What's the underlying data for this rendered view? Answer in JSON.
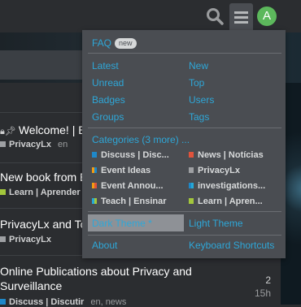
{
  "header": {
    "avatar_letter": "A"
  },
  "menu": {
    "faq": "FAQ",
    "faq_badge": "new",
    "links_left": [
      "Latest",
      "Unread",
      "Badges",
      "Groups"
    ],
    "links_right": [
      "New",
      "Top",
      "Users",
      "Tags"
    ],
    "categories_label": "Categories (3 more) ...",
    "categories": [
      {
        "label": "Discuss | Disc...",
        "color": "#1e88c9"
      },
      {
        "label": "News | Notícias",
        "color": "#e0533c"
      },
      {
        "label": "Event Ideas",
        "color": "#f39c12"
      },
      {
        "label": "PrivacyLx",
        "color": "#9ea0a3"
      },
      {
        "label": "Event Annou...",
        "color": "#f39c12"
      },
      {
        "label": "investigations...",
        "color": "#1e88c9"
      },
      {
        "label": "Teach | Ensinar",
        "color": "#25a9d6"
      },
      {
        "label": "Learn | Apren...",
        "color": "#a3c73c"
      }
    ],
    "dark_theme": "Dark Theme *",
    "light_theme": "Light Theme",
    "about": "About",
    "shortcuts": "Keyboard Shortcuts"
  },
  "topics": [
    {
      "title": "Welcome! | Be",
      "category": "PrivacyLx",
      "cat_color": "#9ea0a3",
      "tag": "en"
    },
    {
      "title": "New book from Ed",
      "category": "Learn | Aprender",
      "cat_color": "#a3c73c",
      "tag": ""
    },
    {
      "title": "PrivacyLx and Tool",
      "category": "PrivacyLx",
      "cat_color": "#9ea0a3",
      "tag": ""
    },
    {
      "title": "Online Publications about Privacy and",
      "title2": "Surveillance",
      "category": "Discuss | Discutir",
      "cat_color": "#1e88c9",
      "tag": "en, news",
      "replies": "2",
      "age": "15h"
    }
  ]
}
